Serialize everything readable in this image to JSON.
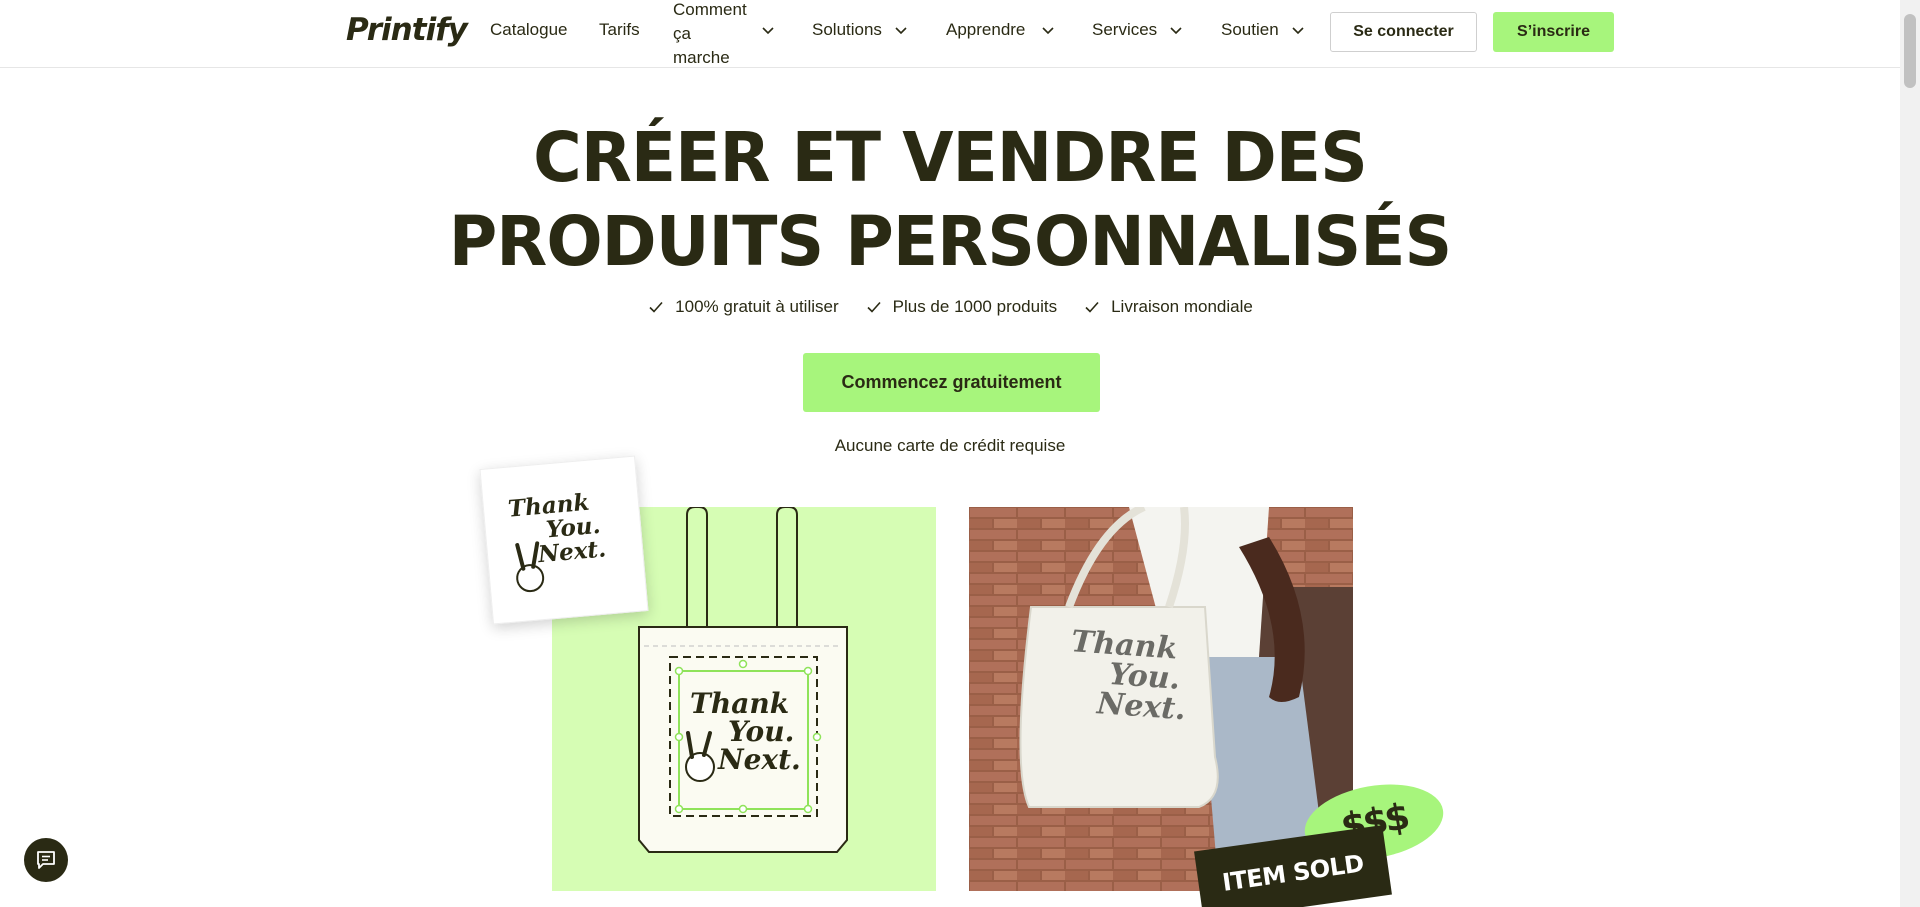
{
  "header": {
    "logo": "Printify",
    "nav": {
      "catalogue": "Catalogue",
      "tarifs": "Tarifs",
      "comment_line1": "Comment",
      "comment_line2": "ça",
      "comment_line3": "marche",
      "solutions": "Solutions",
      "apprendre": "Apprendre",
      "services": "Services",
      "soutien": "Soutien"
    },
    "login_label": "Se connecter",
    "signup_label": "S’inscrire"
  },
  "hero": {
    "title_line1": "CRÉER ET VENDRE DES",
    "title_line2": "PRODUITS PERSONNALISÉS",
    "features": [
      "100% gratuit à utiliser",
      "Plus de 1000 produits",
      "Livraison mondiale"
    ],
    "cta_label": "Commencez gratuitement",
    "cta_sub": "Aucune carte de crédit requise"
  },
  "images": {
    "design_text_1": "Thank",
    "design_text_2": "You.",
    "design_text_3": "Next.",
    "sold_label": "ITEM SOLD",
    "money_label": "$$$"
  },
  "colors": {
    "brand_green": "#a7f57c",
    "panel_green": "#d6fdb4",
    "dark": "#2a2a14"
  },
  "icons": {
    "chat": "chat-icon",
    "check": "check-icon",
    "chevron": "chevron-down-icon"
  }
}
